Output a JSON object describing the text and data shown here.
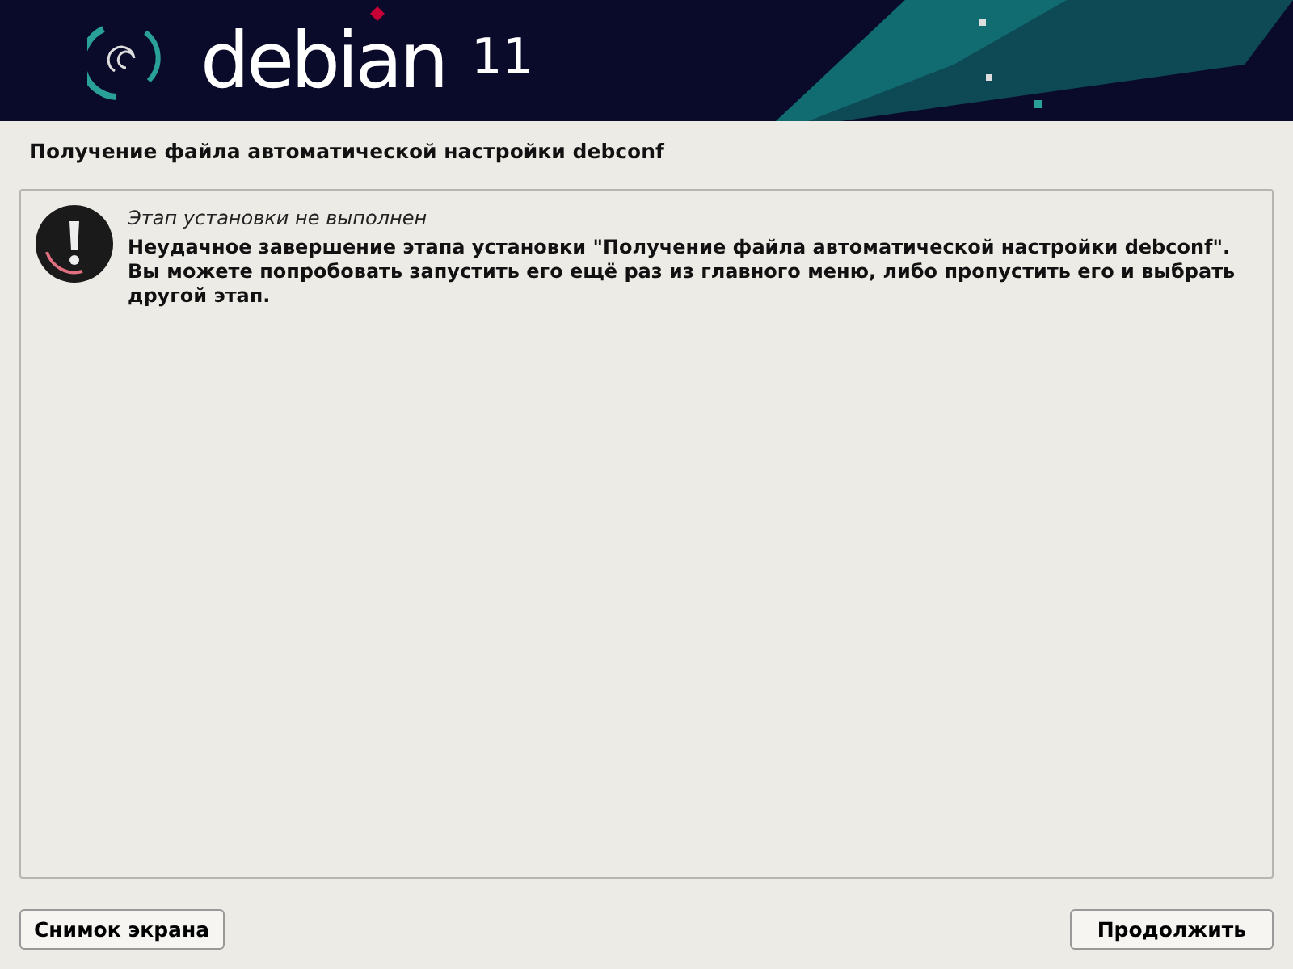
{
  "banner": {
    "brand": "debian",
    "version": "11"
  },
  "title": "Получение файла автоматической настройки debconf",
  "message": {
    "heading": "Этап установки не выполнен",
    "body": "Неудачное завершение этапа установки \"Получение файла автоматической настройки debconf\". Вы можете попробовать запустить его ещё раз из главного меню, либо пропустить его и выбрать другой этап."
  },
  "buttons": {
    "left": "Снимок экрана",
    "right": "Продолжить"
  }
}
